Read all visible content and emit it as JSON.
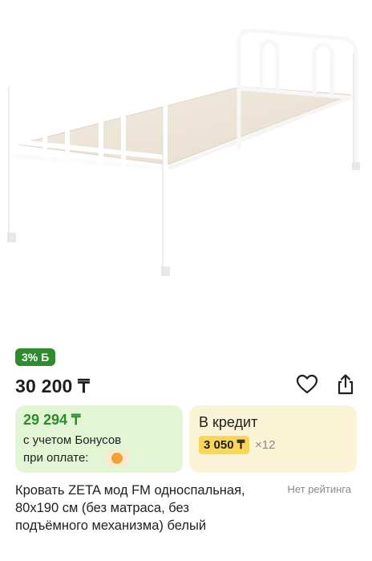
{
  "product": {
    "image_alt": "bed-photo",
    "bonus_badge": "3% Б",
    "price": "30 200 ₸",
    "bonus_card": {
      "price": "29 294 ₸",
      "line1": "с учетом Бонусов",
      "line2": "при оплате:"
    },
    "credit_card": {
      "title": "В кредит",
      "monthly": "3 050 ₸",
      "months": "×12"
    },
    "title": "Кровать ZETA мод FM односпальная, 80х190 см (без матраса, без подъёмного механизма) белый",
    "rating": "Нет рейтинга"
  },
  "icons": {
    "favorite": "heart-icon",
    "share": "share-icon",
    "payment": "payment-coin-icon"
  },
  "colors": {
    "green": "#2e8b2e",
    "bonus_bg": "#e2f6d6",
    "credit_bg": "#fbf3d6",
    "credit_chip": "#f9d65a"
  }
}
